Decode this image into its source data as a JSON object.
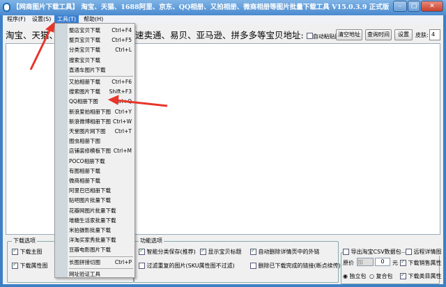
{
  "title": "【网商图片下载工具】 淘宝、天猫、1688阿里、京东、QQ相册、又拍相册、微商相册等图片批量下载工具 V15.0.3.9 正式版",
  "window_buttons": {
    "minimize": "–",
    "maximize": "□",
    "close": "✕"
  },
  "menubar": [
    "程序(F)",
    "设置(S)",
    "工具(T)",
    "帮助(H)"
  ],
  "url_label": "淘宝、天猫、",
  "url_label_rest": "速卖通、易贝、亚马逊、拼多多等宝贝地址:",
  "auto_paste": "自动粘贴网址",
  "buttons": {
    "clear": "清空地址",
    "query_time": "查询时间",
    "settings": "设置"
  },
  "skin_label": "皮肤:",
  "skin_value": "4",
  "tools_menu": {
    "items": [
      {
        "label": "整店宝贝下载",
        "shortcut": "Ctrl+F4"
      },
      {
        "label": "整页宝贝下载",
        "shortcut": "Ctrl+F5"
      },
      {
        "label": "分类宝贝下载",
        "shortcut": "Ctrl+L"
      },
      {
        "label": "搜索宝贝下载",
        "shortcut": ""
      },
      {
        "label": "直通车图片下载",
        "shortcut": ""
      },
      {
        "label": "又拍相册下载",
        "shortcut": "Ctrl+F6"
      },
      {
        "label": "搜索图片下载",
        "shortcut": "Shift+F3"
      },
      {
        "label": "QQ相册下图",
        "shortcut": "Ctrl+Q"
      },
      {
        "label": "新浪爱拍相册下图",
        "shortcut": "Ctrl+Y"
      },
      {
        "label": "新浪微博相册下图",
        "shortcut": "Ctrl+W"
      },
      {
        "label": "天堂图片网下图",
        "shortcut": "Ctrl+T"
      },
      {
        "label": "图虫相册下图",
        "shortcut": ""
      },
      {
        "label": "店铺装修模板下图",
        "shortcut": "Ctrl+M"
      },
      {
        "label": "POCO相册下载",
        "shortcut": ""
      },
      {
        "label": "有图相册下载",
        "shortcut": ""
      },
      {
        "label": "微商相册下载",
        "shortcut": ""
      },
      {
        "label": "阿里巴巴相册下载",
        "shortcut": ""
      },
      {
        "label": "贴吧图片批量下载",
        "shortcut": ""
      },
      {
        "label": "花瓣网图片批量下载",
        "shortcut": ""
      },
      {
        "label": "堆糖生活家批量下载",
        "shortcut": ""
      },
      {
        "label": "米拍摄影批量下载",
        "shortcut": ""
      },
      {
        "label": "洋淘买家秀批量下载",
        "shortcut": ""
      },
      {
        "label": "豆瓣电影图片下载",
        "shortcut": ""
      },
      {
        "label": "长图拼接切图",
        "shortcut": "Ctrl+P"
      },
      {
        "label": "网址验证工具",
        "shortcut": ""
      }
    ]
  },
  "download_options": {
    "legend": "下载选项",
    "items": [
      {
        "label": "下载主图",
        "checked": true
      },
      {
        "label": "下载属性图",
        "checked": true
      }
    ]
  },
  "function_options": {
    "legend": "功能选项",
    "items": [
      {
        "label": "智能分类保存(推荐)",
        "checked": true
      },
      {
        "label": "显示宝贝标题",
        "checked": true
      },
      {
        "label": "自动删除详情页中的外链",
        "checked": true
      },
      {
        "label": "过滤重复的图片(SKU属性图不过滤)",
        "checked": false
      },
      {
        "label": "删除已下载完成的链接(断点续传)",
        "checked": false
      }
    ]
  },
  "csv": {
    "export": "导出淘宝CSV数据包",
    "remote": "远程详情图",
    "price_label": "原价",
    "price_op": "加",
    "price_value": "0",
    "unit": "元",
    "sales_attr": "下载销售属性",
    "category_attr": "下载类目属性",
    "standalone": "独立包",
    "composite": "复合包"
  }
}
